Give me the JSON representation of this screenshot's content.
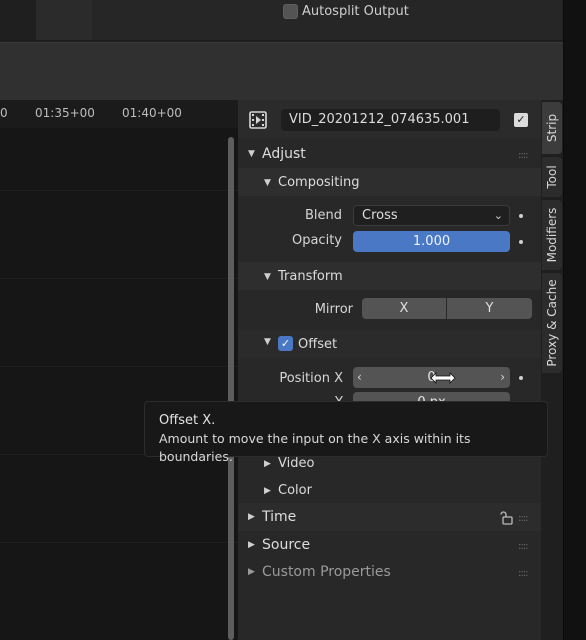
{
  "topbar": {
    "autosplit_label": "Autosplit Output",
    "autosplit_checked": false
  },
  "timeline": {
    "ticks": [
      "0",
      "01:35+00",
      "01:40+00"
    ]
  },
  "properties": {
    "strip_name": "VID_20201212_074635.001",
    "strip_enabled": true,
    "adjust": {
      "label": "Adjust",
      "compositing": {
        "label": "Compositing",
        "blend_label": "Blend",
        "blend_value": "Cross",
        "opacity_label": "Opacity",
        "opacity_value": "1.000"
      },
      "transform": {
        "label": "Transform",
        "mirror_label": "Mirror",
        "mirror_x": "X",
        "mirror_y": "Y",
        "offset_label": "Offset",
        "offset_checked": true,
        "position_x_label": "Position X",
        "position_x_value": "0",
        "position_y_label": "Y",
        "position_y_value": "0 px"
      },
      "video_label": "Video",
      "color_label": "Color"
    },
    "time_label": "Time",
    "source_label": "Source",
    "custom_properties_label": "Custom Properties"
  },
  "tabs": [
    "Strip",
    "Tool",
    "Modifiers",
    "Proxy & Cache"
  ],
  "tooltip": {
    "title": "Offset X.",
    "description": "Amount to move the input on the X axis within its boundaries."
  },
  "colors": {
    "accent": "#4a78c4",
    "panel_bg": "#282828",
    "timeline_bg": "#161616"
  }
}
